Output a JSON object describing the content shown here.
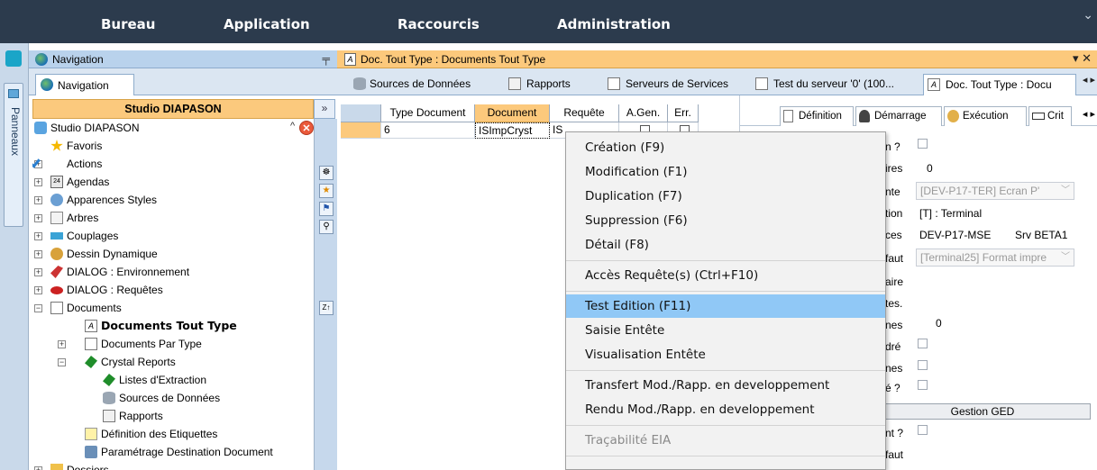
{
  "menubar": {
    "items": [
      "Bureau",
      "Application",
      "Raccourcis",
      "Administration"
    ],
    "chevron": "⌄"
  },
  "panneaux": {
    "label": "Panneaux"
  },
  "navigation": {
    "title": "Navigation",
    "pin": "📌",
    "tab_label": "Navigation",
    "studio_header": "Studio DIAPASON",
    "collapse": "»",
    "tree": [
      {
        "label": "Studio DIAPASON",
        "level": 0,
        "expander": "",
        "icon": "studio-icon"
      },
      {
        "label": "Favoris",
        "level": 1,
        "expander": "",
        "icon": "star-icon"
      },
      {
        "label": "Actions",
        "level": 1,
        "expander": "+",
        "icon": "check-icon"
      },
      {
        "label": "Agendas",
        "level": 1,
        "expander": "+",
        "icon": "calendar-icon"
      },
      {
        "label": "Apparences Styles",
        "level": 1,
        "expander": "+",
        "icon": "palette-icon"
      },
      {
        "label": "Arbres",
        "level": 1,
        "expander": "+",
        "icon": "tree-icon"
      },
      {
        "label": "Couplages",
        "level": 1,
        "expander": "+",
        "icon": "coupling-icon"
      },
      {
        "label": "Dessin Dynamique",
        "level": 1,
        "expander": "+",
        "icon": "drawing-icon"
      },
      {
        "label": "DIALOG : Environnement",
        "level": 1,
        "expander": "+",
        "icon": "dialog-env-icon"
      },
      {
        "label": "DIALOG : Requêtes",
        "level": 1,
        "expander": "+",
        "icon": "dialog-query-icon"
      },
      {
        "label": "Documents",
        "level": 1,
        "expander": "−",
        "icon": "document-icon"
      },
      {
        "label": "Documents Tout Type",
        "level": 2,
        "expander": "",
        "icon": "doc-all-type-icon",
        "bold": true
      },
      {
        "label": "Documents Par Type",
        "level": 2,
        "expander": "+",
        "icon": "document-icon"
      },
      {
        "label": "Crystal Reports",
        "level": 2,
        "expander": "−",
        "icon": "crystal-icon"
      },
      {
        "label": "Listes d'Extraction",
        "level": 3,
        "expander": "",
        "icon": "crystal-icon"
      },
      {
        "label": "Sources de Données",
        "level": 3,
        "expander": "",
        "icon": "database-icon"
      },
      {
        "label": "Rapports",
        "level": 3,
        "expander": "",
        "icon": "report-icon"
      },
      {
        "label": "Définition des Etiquettes",
        "level": 2,
        "expander": "",
        "icon": "label-icon"
      },
      {
        "label": "Paramétrage Destination Document",
        "level": 2,
        "expander": "",
        "icon": "printer-icon"
      },
      {
        "label": "Dossiers",
        "level": 1,
        "expander": "+",
        "icon": "folder-icon"
      }
    ],
    "close": "✕",
    "scroll_up": "^"
  },
  "main": {
    "title": "Doc. Tout Type : Documents Tout Type",
    "controls": "▾ ✕",
    "tabs": [
      {
        "label": "Sources de Données",
        "icon": "database-icon"
      },
      {
        "label": "Rapports",
        "icon": "report-icon"
      },
      {
        "label": "Serveurs de Services",
        "icon": "document-icon"
      },
      {
        "label": "Test du serveur '0' (100...",
        "icon": "document-icon"
      },
      {
        "label": "Doc. Tout Type : Docu",
        "icon": "doc-all-type-icon",
        "active": true
      }
    ],
    "tab_nav": "◂ ▸",
    "grid": {
      "columns": [
        "Type Document",
        "Document",
        "Requête",
        "A.Gen.",
        "Err."
      ],
      "row": {
        "type_document": "6",
        "document": "ISImpCryst",
        "requete": "IS"
      }
    }
  },
  "right_panel": {
    "tabs": [
      "Définition",
      "Démarrage",
      "Exécution",
      "Crit"
    ],
    "tab_nav": "◂ ▸",
    "fields": [
      {
        "label": "n ?",
        "kind": "checkbox"
      },
      {
        "label": "ires",
        "value": "0"
      },
      {
        "label": "nte",
        "select": "[DEV-P17-TER] Ecran P'"
      },
      {
        "label": "tion",
        "value": "[T] : Terminal"
      },
      {
        "label": "ces",
        "value": "DEV-P17-MSE",
        "value2": "Srv BETA1"
      },
      {
        "label": "faut",
        "select": "[Terminal25] Format impre"
      },
      {
        "label": "aire"
      },
      {
        "label": "tes."
      },
      {
        "label": "nes",
        "value": "0"
      },
      {
        "label": "dré",
        "kind": "checkbox"
      },
      {
        "label": "nes",
        "kind": "checkbox"
      },
      {
        "label": "é ?",
        "kind": "checkbox"
      },
      {
        "label": "nt ?",
        "kind": "checkbox"
      },
      {
        "label": "faut"
      }
    ],
    "ged_button": "Gestion GED"
  },
  "context_menu": {
    "items": [
      {
        "label": "Création (F9)"
      },
      {
        "label": "Modification (F1)"
      },
      {
        "label": "Duplication (F7)"
      },
      {
        "label": "Suppression (F6)"
      },
      {
        "label": "Détail (F8)"
      },
      {
        "sep": true
      },
      {
        "label": "Accès Requête(s) (Ctrl+F10)"
      },
      {
        "sep": true
      },
      {
        "label": "Test Edition (F11)",
        "highlighted": true
      },
      {
        "label": "Saisie Entête"
      },
      {
        "label": "Visualisation Entête"
      },
      {
        "sep": true
      },
      {
        "label": "Transfert Mod./Rapp. en developpement"
      },
      {
        "label": "Rendu Mod./Rapp. en developpement"
      },
      {
        "sep": true
      },
      {
        "label": "Traçabilité EIA",
        "disabled": true
      },
      {
        "sep": true
      }
    ]
  },
  "colors": {
    "menubar": "#2c3b4d",
    "accent_orange": "#fcc97c",
    "highlight": "#90c8f6",
    "panel_blue": "#c9d9ea"
  }
}
